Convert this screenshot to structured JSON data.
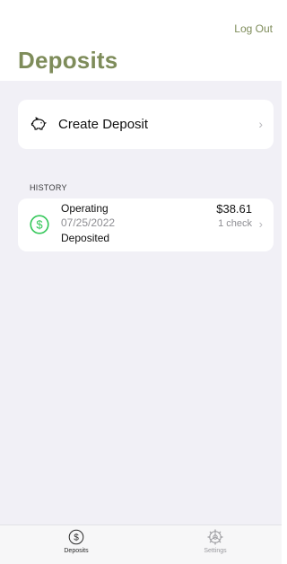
{
  "header": {
    "logout_label": "Log Out",
    "title": "Deposits"
  },
  "create_deposit": {
    "icon": "piggy-bank-icon",
    "label": "Create Deposit"
  },
  "history": {
    "section_label": "HISTORY",
    "items": [
      {
        "icon": "dollar-circle-icon",
        "account": "Operating",
        "date": "07/25/2022",
        "status": "Deposited",
        "amount": "$38.61",
        "checks": "1 check"
      }
    ]
  },
  "tabbar": {
    "tabs": [
      {
        "label": "Deposits",
        "icon": "dollar-circle-icon",
        "selected": true
      },
      {
        "label": "Settings",
        "icon": "gear-icon",
        "selected": false
      }
    ]
  },
  "colors": {
    "accent": "#7e8c5a",
    "success_green": "#34c759",
    "background": "#f1f0f6"
  }
}
